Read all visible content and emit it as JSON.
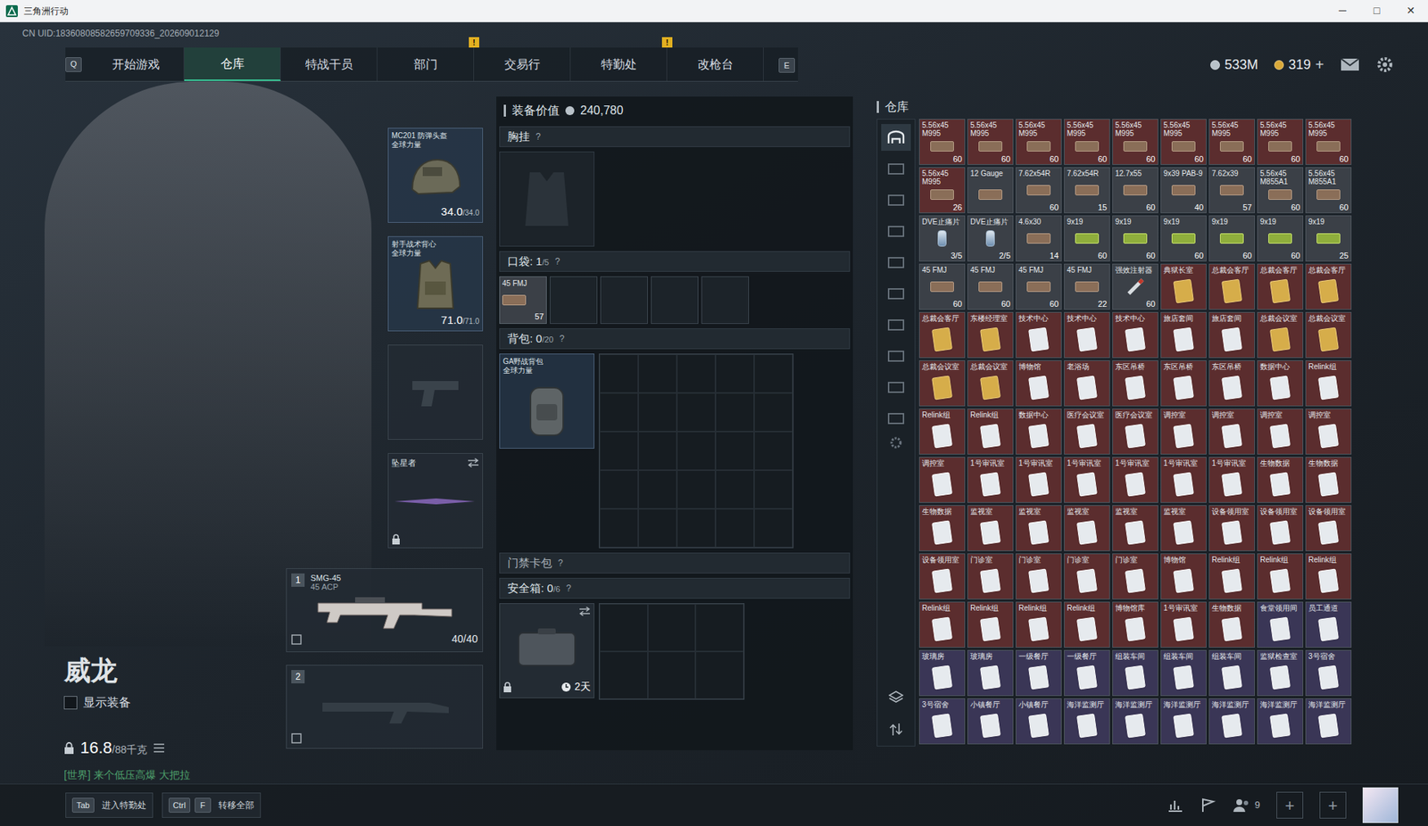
{
  "window": {
    "title": "三角洲行动",
    "controls": [
      "─",
      "□",
      "✕"
    ]
  },
  "uid": "CN UID:18360808582659709336_202609012129",
  "nav": {
    "left_key": "Q",
    "right_key": "E",
    "tabs": [
      {
        "label": "开始游戏",
        "selected": false,
        "alert": ""
      },
      {
        "label": "仓库",
        "selected": true,
        "alert": ""
      },
      {
        "label": "特战干员",
        "selected": false,
        "alert": ""
      },
      {
        "label": "部门",
        "selected": false,
        "alert": "!"
      },
      {
        "label": "交易行",
        "selected": false,
        "alert": ""
      },
      {
        "label": "特勤处",
        "selected": false,
        "alert": "!"
      },
      {
        "label": "改枪台",
        "selected": false,
        "alert": ""
      }
    ]
  },
  "currency": [
    {
      "value": "533M",
      "color": "#b9c2c9",
      "plus": ""
    },
    {
      "value": "319",
      "color": "#d9a93a",
      "plus": "+"
    }
  ],
  "character": {
    "name": "威龙",
    "show_gear": {
      "label": "显示装备",
      "checked": false
    },
    "weight": {
      "value": "16.8",
      "max": "/88千克"
    },
    "chat": "[世界] 来个低压高爆 大把拉"
  },
  "equipment": {
    "helmet": {
      "label": "MC201 防弹头盔",
      "sub": "全球力量",
      "durability": "34.0",
      "max": "/34.0"
    },
    "armor": {
      "label": "射手战术背心",
      "sub": "全球力量",
      "durability": "71.0",
      "max": "/71.0"
    },
    "melee": {
      "label": "坠星者",
      "locked": true
    },
    "weapons": [
      {
        "slot": "1",
        "name": "SMG-45",
        "ammo_type": "45 ACP",
        "ammo": "40/40",
        "empty": false
      },
      {
        "slot": "2",
        "name": "",
        "ammo_type": "",
        "ammo": "",
        "empty": true
      }
    ]
  },
  "loadout": {
    "value_label": "装备价值",
    "value": "240,780",
    "chest": {
      "label": "胸挂",
      "help": "?"
    },
    "pocket": {
      "label": "口袋:",
      "used": "1",
      "capacity": "/5",
      "help": "?",
      "slot_count": 5,
      "items": [
        {
          "label": "45 FMJ",
          "count": "57"
        }
      ]
    },
    "backpack": {
      "label": "背包:",
      "used": "0",
      "capacity": "/20",
      "help": "?",
      "item": {
        "label": "GA野战背包",
        "sub": "全球力量"
      }
    },
    "keycard": {
      "label": "门禁卡包",
      "help": "?"
    },
    "safe": {
      "label": "安全箱:",
      "used": "0",
      "capacity": "/6",
      "help": "?",
      "timer": "2天",
      "locked": true
    }
  },
  "warehouse": {
    "title": "仓库",
    "sidebar_tabs": [
      {
        "selected": true
      },
      {
        "selected": false
      },
      {
        "selected": false
      },
      {
        "selected": false
      },
      {
        "selected": false
      },
      {
        "selected": false
      },
      {
        "selected": false
      },
      {
        "selected": false
      },
      {
        "selected": false
      },
      {
        "selected": false
      }
    ],
    "items": [
      {
        "label": "5.56x45 M995",
        "count": "60",
        "color": "#5b2d2e",
        "kind": "ammo"
      },
      {
        "label": "5.56x45 M995",
        "count": "60",
        "color": "#5b2d2e",
        "kind": "ammo"
      },
      {
        "label": "5.56x45 M995",
        "count": "60",
        "color": "#5b2d2e",
        "kind": "ammo"
      },
      {
        "label": "5.56x45 M995",
        "count": "60",
        "color": "#5b2d2e",
        "kind": "ammo"
      },
      {
        "label": "5.56x45 M995",
        "count": "60",
        "color": "#5b2d2e",
        "kind": "ammo"
      },
      {
        "label": "5.56x45 M995",
        "count": "60",
        "color": "#5b2d2e",
        "kind": "ammo"
      },
      {
        "label": "5.56x45 M995",
        "count": "60",
        "color": "#5b2d2e",
        "kind": "ammo"
      },
      {
        "label": "5.56x45 M995",
        "count": "60",
        "color": "#5b2d2e",
        "kind": "ammo"
      },
      {
        "label": "5.56x45 M995",
        "count": "60",
        "color": "#5b2d2e",
        "kind": "ammo"
      },
      {
        "label": "5.56x45 M995",
        "count": "26",
        "color": "#5b2d2e",
        "kind": "ammo"
      },
      {
        "label": "12 Gauge",
        "count": "",
        "color": "#3b4047",
        "kind": "ammo"
      },
      {
        "label": "7.62x54R",
        "count": "60",
        "color": "#3b4047",
        "kind": "ammo"
      },
      {
        "label": "7.62x54R",
        "count": "15",
        "color": "#3b4047",
        "kind": "ammo"
      },
      {
        "label": "12.7x55",
        "count": "60",
        "color": "#3b4047",
        "kind": "ammo"
      },
      {
        "label": "9x39 PAB-9",
        "count": "40",
        "color": "#3b4047",
        "kind": "ammo"
      },
      {
        "label": "7.62x39",
        "count": "57",
        "color": "#3b4047",
        "kind": "ammo"
      },
      {
        "label": "5.56x45 M855A1",
        "count": "60",
        "color": "#3b4047",
        "kind": "ammo"
      },
      {
        "label": "5.56x45 M855A1",
        "count": "60",
        "color": "#3b4047",
        "kind": "ammo"
      },
      {
        "label": "DVE止痛片",
        "count": "3/5",
        "color": "#3b4047",
        "kind": "pill"
      },
      {
        "label": "DVE止痛片",
        "count": "2/5",
        "color": "#3b4047",
        "kind": "pill"
      },
      {
        "label": "4.6x30",
        "count": "14",
        "color": "#3b4047",
        "kind": "ammo"
      },
      {
        "label": "9x19",
        "count": "60",
        "color": "#3b4047",
        "kind": "ammo-green"
      },
      {
        "label": "9x19",
        "count": "60",
        "color": "#3b4047",
        "kind": "ammo-green"
      },
      {
        "label": "9x19",
        "count": "60",
        "color": "#3b4047",
        "kind": "ammo-green"
      },
      {
        "label": "9x19",
        "count": "60",
        "color": "#3b4047",
        "kind": "ammo-green"
      },
      {
        "label": "9x19",
        "count": "60",
        "color": "#3b4047",
        "kind": "ammo-green"
      },
      {
        "label": "9x19",
        "count": "25",
        "color": "#3b4047",
        "kind": "ammo-green"
      },
      {
        "label": "45 FMJ",
        "count": "60",
        "color": "#3b4047",
        "kind": "ammo"
      },
      {
        "label": "45 FMJ",
        "count": "60",
        "color": "#3b4047",
        "kind": "ammo"
      },
      {
        "label": "45 FMJ",
        "count": "60",
        "color": "#3b4047",
        "kind": "ammo"
      },
      {
        "label": "45 FMJ",
        "count": "22",
        "color": "#3b4047",
        "kind": "ammo"
      },
      {
        "label": "强效注射器",
        "count": "60",
        "color": "#3b4047",
        "kind": "syringe"
      },
      {
        "label": "典狱长室",
        "count": "",
        "color": "#5b2d2e",
        "kind": "card-gold"
      },
      {
        "label": "总裁会客厅",
        "count": "",
        "color": "#5b2d2e",
        "kind": "card-gold"
      },
      {
        "label": "总裁会客厅",
        "count": "",
        "color": "#5b2d2e",
        "kind": "card-gold"
      },
      {
        "label": "总裁会客厅",
        "count": "",
        "color": "#5b2d2e",
        "kind": "card-gold"
      },
      {
        "label": "总裁会客厅",
        "count": "",
        "color": "#5b2d2e",
        "kind": "card-gold"
      },
      {
        "label": "东楼经理室",
        "count": "",
        "color": "#5b2d2e",
        "kind": "card-gold"
      },
      {
        "label": "技术中心",
        "count": "",
        "color": "#5b2d2e",
        "kind": "card"
      },
      {
        "label": "技术中心",
        "count": "",
        "color": "#5b2d2e",
        "kind": "card"
      },
      {
        "label": "技术中心",
        "count": "",
        "color": "#5b2d2e",
        "kind": "card"
      },
      {
        "label": "旅店套间",
        "count": "",
        "color": "#5b2d2e",
        "kind": "card"
      },
      {
        "label": "旅店套间",
        "count": "",
        "color": "#5b2d2e",
        "kind": "card"
      },
      {
        "label": "总裁会议室",
        "count": "",
        "color": "#5b2d2e",
        "kind": "card-gold"
      },
      {
        "label": "总裁会议室",
        "count": "",
        "color": "#5b2d2e",
        "kind": "card-gold"
      },
      {
        "label": "总裁会议室",
        "count": "",
        "color": "#5b2d2e",
        "kind": "card-gold"
      },
      {
        "label": "总裁会议室",
        "count": "",
        "color": "#5b2d2e",
        "kind": "card-gold"
      },
      {
        "label": "博物馆",
        "count": "",
        "color": "#5b2d2e",
        "kind": "card"
      },
      {
        "label": "老浴场",
        "count": "",
        "color": "#5b2d2e",
        "kind": "card"
      },
      {
        "label": "东区吊桥",
        "count": "",
        "color": "#5b2d2e",
        "kind": "card"
      },
      {
        "label": "东区吊桥",
        "count": "",
        "color": "#5b2d2e",
        "kind": "card"
      },
      {
        "label": "东区吊桥",
        "count": "",
        "color": "#5b2d2e",
        "kind": "card"
      },
      {
        "label": "数据中心",
        "count": "",
        "color": "#5b2d2e",
        "kind": "card"
      },
      {
        "label": "Relink组",
        "count": "",
        "color": "#5b2d2e",
        "kind": "card"
      },
      {
        "label": "Relink组",
        "count": "",
        "color": "#5b2d2e",
        "kind": "card"
      },
      {
        "label": "Relink组",
        "count": "",
        "color": "#5b2d2e",
        "kind": "card"
      },
      {
        "label": "数据中心",
        "count": "",
        "color": "#5b2d2e",
        "kind": "card"
      },
      {
        "label": "医疗会议室",
        "count": "",
        "color": "#5b2d2e",
        "kind": "card"
      },
      {
        "label": "医疗会议室",
        "count": "",
        "color": "#5b2d2e",
        "kind": "card"
      },
      {
        "label": "调控室",
        "count": "",
        "color": "#5b2d2e",
        "kind": "card"
      },
      {
        "label": "调控室",
        "count": "",
        "color": "#5b2d2e",
        "kind": "card"
      },
      {
        "label": "调控室",
        "count": "",
        "color": "#5b2d2e",
        "kind": "card"
      },
      {
        "label": "调控室",
        "count": "",
        "color": "#5b2d2e",
        "kind": "card"
      },
      {
        "label": "调控室",
        "count": "",
        "color": "#5b2d2e",
        "kind": "card"
      },
      {
        "label": "1号审讯室",
        "count": "",
        "color": "#5b2d2e",
        "kind": "card"
      },
      {
        "label": "1号审讯室",
        "count": "",
        "color": "#5b2d2e",
        "kind": "card"
      },
      {
        "label": "1号审讯室",
        "count": "",
        "color": "#5b2d2e",
        "kind": "card"
      },
      {
        "label": "1号审讯室",
        "count": "",
        "color": "#5b2d2e",
        "kind": "card"
      },
      {
        "label": "1号审讯室",
        "count": "",
        "color": "#5b2d2e",
        "kind": "card"
      },
      {
        "label": "1号审讯室",
        "count": "",
        "color": "#5b2d2e",
        "kind": "card"
      },
      {
        "label": "生物数据",
        "count": "",
        "color": "#5b2d2e",
        "kind": "card"
      },
      {
        "label": "生物数据",
        "count": "",
        "color": "#5b2d2e",
        "kind": "card"
      },
      {
        "label": "生物数据",
        "count": "",
        "color": "#5b2d2e",
        "kind": "card"
      },
      {
        "label": "监视室",
        "count": "",
        "color": "#5b2d2e",
        "kind": "card"
      },
      {
        "label": "监视室",
        "count": "",
        "color": "#5b2d2e",
        "kind": "card"
      },
      {
        "label": "监视室",
        "count": "",
        "color": "#5b2d2e",
        "kind": "card"
      },
      {
        "label": "监视室",
        "count": "",
        "color": "#5b2d2e",
        "kind": "card"
      },
      {
        "label": "监视室",
        "count": "",
        "color": "#5b2d2e",
        "kind": "card"
      },
      {
        "label": "设备领用室",
        "count": "",
        "color": "#5b2d2e",
        "kind": "card"
      },
      {
        "label": "设备领用室",
        "count": "",
        "color": "#5b2d2e",
        "kind": "card"
      },
      {
        "label": "设备领用室",
        "count": "",
        "color": "#5b2d2e",
        "kind": "card"
      },
      {
        "label": "设备领用室",
        "count": "",
        "color": "#5b2d2e",
        "kind": "card"
      },
      {
        "label": "门诊室",
        "count": "",
        "color": "#5b2d2e",
        "kind": "card"
      },
      {
        "label": "门诊室",
        "count": "",
        "color": "#5b2d2e",
        "kind": "card"
      },
      {
        "label": "门诊室",
        "count": "",
        "color": "#5b2d2e",
        "kind": "card"
      },
      {
        "label": "门诊室",
        "count": "",
        "color": "#5b2d2e",
        "kind": "card"
      },
      {
        "label": "博物馆",
        "count": "",
        "color": "#5b2d2e",
        "kind": "card"
      },
      {
        "label": "Relink组",
        "count": "",
        "color": "#5b2d2e",
        "kind": "card"
      },
      {
        "label": "Relink组",
        "count": "",
        "color": "#5b2d2e",
        "kind": "card"
      },
      {
        "label": "Relink组",
        "count": "",
        "color": "#5b2d2e",
        "kind": "card"
      },
      {
        "label": "Relink组",
        "count": "",
        "color": "#5b2d2e",
        "kind": "card"
      },
      {
        "label": "Relink组",
        "count": "",
        "color": "#5b2d2e",
        "kind": "card"
      },
      {
        "label": "Relink组",
        "count": "",
        "color": "#5b2d2e",
        "kind": "card"
      },
      {
        "label": "Relink组",
        "count": "",
        "color": "#5b2d2e",
        "kind": "card"
      },
      {
        "label": "博物馆库",
        "count": "",
        "color": "#5b2d2e",
        "kind": "card"
      },
      {
        "label": "1号审讯室",
        "count": "",
        "color": "#5b2d2e",
        "kind": "card"
      },
      {
        "label": "生物数据",
        "count": "",
        "color": "#5b2d2e",
        "kind": "card"
      },
      {
        "label": "食堂领用间",
        "count": "",
        "color": "#3a3656",
        "kind": "card"
      },
      {
        "label": "员工通道",
        "count": "",
        "color": "#3a3656",
        "kind": "card"
      },
      {
        "label": "玻璃房",
        "count": "",
        "color": "#3a3656",
        "kind": "card"
      },
      {
        "label": "玻璃房",
        "count": "",
        "color": "#3a3656",
        "kind": "card"
      },
      {
        "label": "一级餐厅",
        "count": "",
        "color": "#3a3656",
        "kind": "card"
      },
      {
        "label": "一级餐厅",
        "count": "",
        "color": "#3a3656",
        "kind": "card"
      },
      {
        "label": "组装车间",
        "count": "",
        "color": "#3a3656",
        "kind": "card"
      },
      {
        "label": "组装车间",
        "count": "",
        "color": "#3a3656",
        "kind": "card"
      },
      {
        "label": "组装车间",
        "count": "",
        "color": "#3a3656",
        "kind": "card"
      },
      {
        "label": "监狱检查室",
        "count": "",
        "color": "#3a3656",
        "kind": "card"
      },
      {
        "label": "3号宿舍",
        "count": "",
        "color": "#3a3656",
        "kind": "card"
      },
      {
        "label": "3号宿舍",
        "count": "",
        "color": "#3a3656",
        "kind": "card"
      },
      {
        "label": "小镇餐厅",
        "count": "",
        "color": "#3a3656",
        "kind": "card"
      },
      {
        "label": "小镇餐厅",
        "count": "",
        "color": "#3a3656",
        "kind": "card"
      },
      {
        "label": "海洋监测厅",
        "count": "",
        "color": "#3a3656",
        "kind": "card"
      },
      {
        "label": "海洋监测厅",
        "count": "",
        "color": "#3a3656",
        "kind": "card"
      },
      {
        "label": "海洋监测厅",
        "count": "",
        "color": "#3a3656",
        "kind": "card"
      },
      {
        "label": "海洋监测厅",
        "count": "",
        "color": "#3a3656",
        "kind": "card"
      },
      {
        "label": "海洋监测厅",
        "count": "",
        "color": "#3a3656",
        "kind": "card"
      },
      {
        "label": "海洋监测厅",
        "count": "",
        "color": "#3a3656",
        "kind": "card"
      }
    ]
  },
  "bottom_bar": {
    "hints": [
      {
        "keys": [
          "Tab"
        ],
        "label": "进入特勤处"
      },
      {
        "keys": [
          "Ctrl",
          "F"
        ],
        "label": "转移全部"
      }
    ],
    "friends": "9",
    "add_slots": [
      "+",
      "+"
    ]
  }
}
